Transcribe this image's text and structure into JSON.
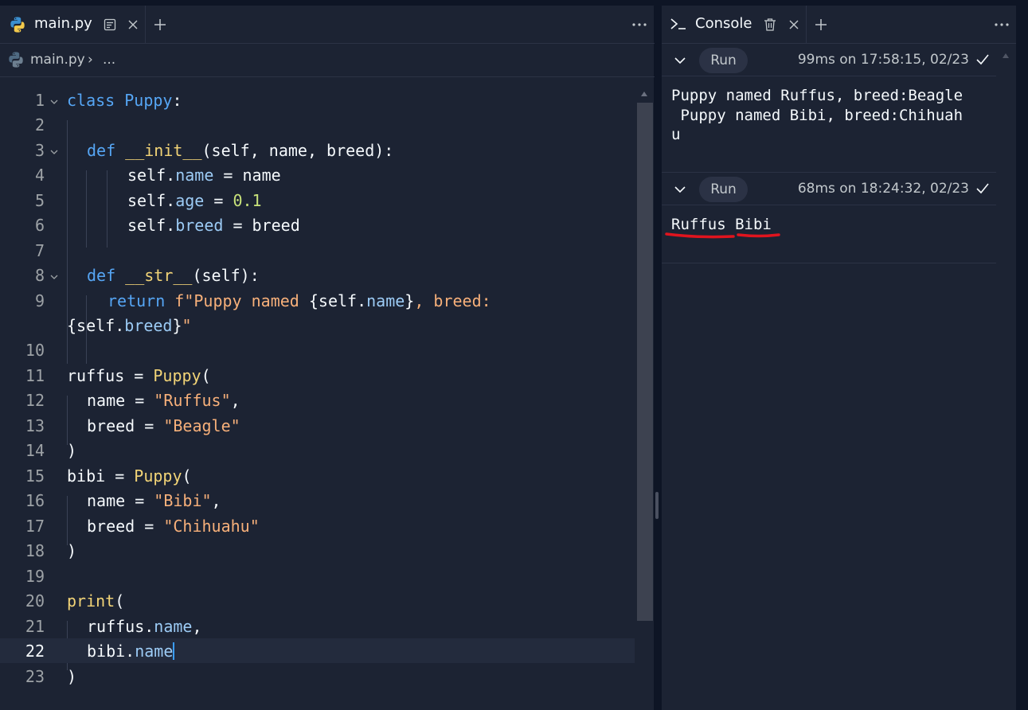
{
  "editor": {
    "tab_title": "main.py",
    "breadcrumb_file": "main.py",
    "breadcrumb_sep": "›",
    "breadcrumb_more": "...",
    "code_lines": [
      {
        "n": "1"
      },
      {
        "n": "2"
      },
      {
        "n": "3"
      },
      {
        "n": "4"
      },
      {
        "n": "5"
      },
      {
        "n": "6"
      },
      {
        "n": "7"
      },
      {
        "n": "8"
      },
      {
        "n": "9"
      },
      {
        "n": "10"
      },
      {
        "n": "11"
      },
      {
        "n": "12"
      },
      {
        "n": "13"
      },
      {
        "n": "14"
      },
      {
        "n": "15"
      },
      {
        "n": "16"
      },
      {
        "n": "17"
      },
      {
        "n": "18"
      },
      {
        "n": "19"
      },
      {
        "n": "20"
      },
      {
        "n": "21"
      },
      {
        "n": "22"
      },
      {
        "n": "23"
      }
    ],
    "tokens": {
      "l1_kw": "class",
      "l1_cls": "Puppy",
      "l1_tail": ":",
      "l3_kw": "def",
      "l3_fn": "__init__",
      "l3_tail": "(self, name, breed):",
      "l4_a": "self.",
      "l4_p": "name",
      "l4_b": " = name",
      "l5_a": "self.",
      "l5_p": "age",
      "l5_b": " = ",
      "l5_num": "0.1",
      "l6_a": "self.",
      "l6_p": "breed",
      "l6_b": " = breed",
      "l8_kw": "def",
      "l8_fn": "__str__",
      "l8_tail": "(self):",
      "l9_kw": "return",
      "l9_s1": " f\"Puppy named ",
      "l9_b1": "{self.",
      "l9_p1": "name",
      "l9_b2": "}",
      "l9_s2": ", breed:",
      "l9w_b1": "{self.",
      "l9w_p1": "breed",
      "l9w_b2": "}",
      "l9w_s": "\"",
      "l11_a": "ruffus = ",
      "l11_fn": "Puppy",
      "l11_b": "(",
      "l12_a": "name = ",
      "l12_s": "\"Ruffus\"",
      "l12_b": ",",
      "l13_a": "breed = ",
      "l13_s": "\"Beagle\"",
      "l14": ")",
      "l15_a": "bibi = ",
      "l15_fn": "Puppy",
      "l15_b": "(",
      "l16_a": "name = ",
      "l16_s": "\"Bibi\"",
      "l16_b": ",",
      "l17_a": "breed = ",
      "l17_s": "\"Chihuahu\"",
      "l18": ")",
      "l20_fn": "print",
      "l20_b": "(",
      "l21_a": "ruffus.",
      "l21_p": "name",
      "l21_b": ",",
      "l22_a": "bibi.",
      "l22_p": "name",
      "l23": ")"
    }
  },
  "console": {
    "tab_title": "Console",
    "runs": [
      {
        "badge": "Run",
        "meta": "99ms on 17:58:15, 02/23",
        "output": "Puppy named Ruffus, breed:Beagle\n Puppy named Bibi, breed:Chihuah\nu"
      },
      {
        "badge": "Run",
        "meta": "68ms on 18:24:32, 02/23",
        "output": "Ruffus Bibi"
      }
    ]
  },
  "colors": {
    "background": "#1c2333",
    "keyword": "#56a6f5",
    "function": "#f2d477",
    "string": "#f7b07a",
    "number": "#c8e27a",
    "annotation": "#e0141e"
  }
}
